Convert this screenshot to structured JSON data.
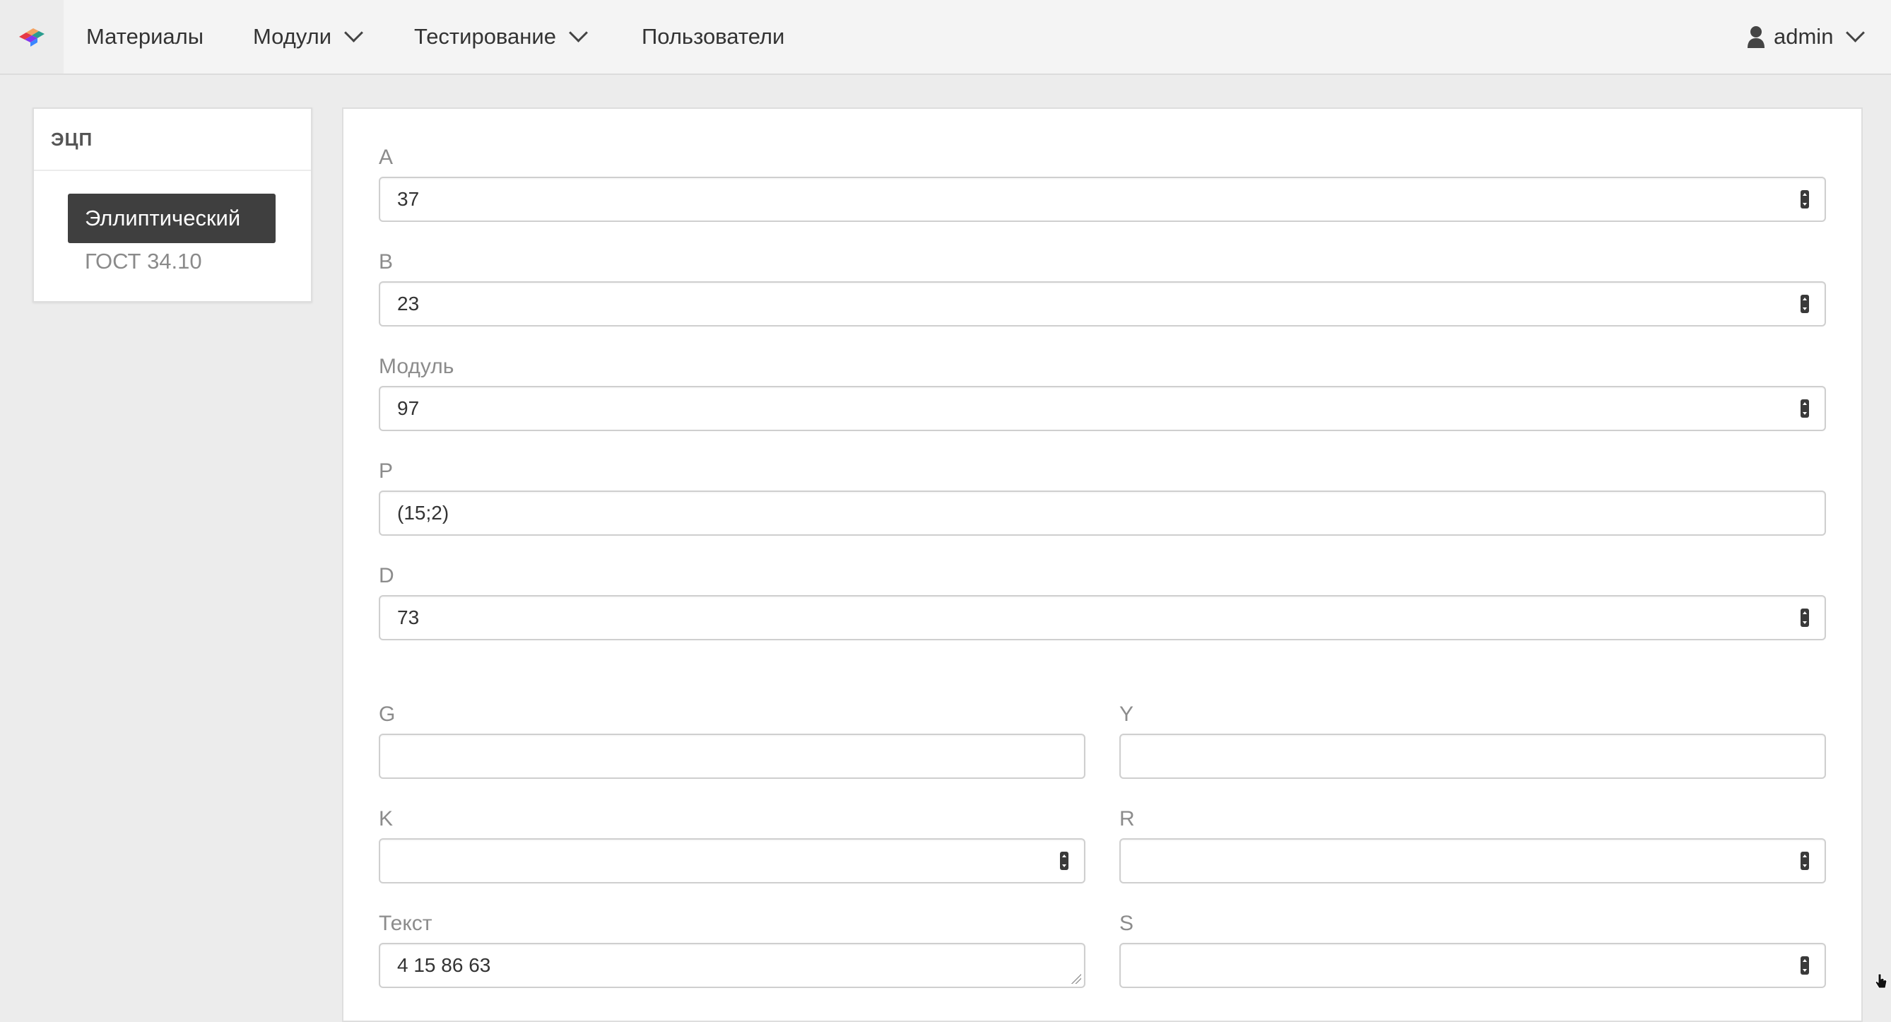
{
  "nav": {
    "items": [
      "Материалы",
      "Модули",
      "Тестирование",
      "Пользователи"
    ],
    "user": "admin"
  },
  "sidebar": {
    "heading": "ЭЦП",
    "active": "Эллиптический",
    "link": "ГОСТ 34.10"
  },
  "form": {
    "a_label": "A",
    "a_value": "37",
    "b_label": "B",
    "b_value": "23",
    "mod_label": "Модуль",
    "mod_value": "97",
    "p_label": "P",
    "p_value": "(15;2)",
    "d_label": "D",
    "d_value": "73",
    "g_label": "G",
    "g_value": "",
    "y_label": "Y",
    "y_value": "",
    "k_label": "K",
    "k_value": "",
    "r_label": "R",
    "r_value": "",
    "text_label": "Текст",
    "text_value": "4 15 86 63",
    "s_label": "S",
    "s_value": ""
  },
  "colors": {
    "accent_dark": "#3f3f3f",
    "background": "#ececec"
  },
  "icons": [
    "logo-icon",
    "chevron-down-icon",
    "user-icon",
    "spinner-icon",
    "resize-grip-icon",
    "cursor-icon"
  ]
}
